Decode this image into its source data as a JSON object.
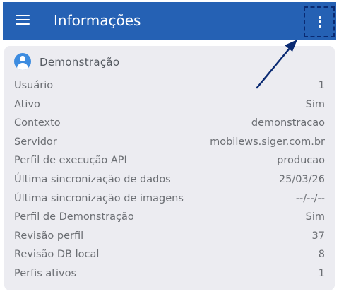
{
  "appbar": {
    "title": "Informações",
    "menu_icon": "hamburger-menu-icon",
    "overflow_icon": "more-vert-icon",
    "color": "#2561b4"
  },
  "card": {
    "icon": "user-avatar-icon",
    "title": "Demonstração",
    "rows": [
      {
        "label": "Usuário",
        "value": "1"
      },
      {
        "label": "Ativo",
        "value": "Sim"
      },
      {
        "label": "Contexto",
        "value": "demonstracao"
      },
      {
        "label": "Servidor",
        "value": "mobilews.siger.com.br"
      },
      {
        "label": "Perfil de execução API",
        "value": "producao"
      },
      {
        "label": "Última sincronização de dados",
        "value": "25/03/26"
      },
      {
        "label": "Última sincronização de imagens",
        "value": "--/--/--"
      },
      {
        "label": "Perfil de Demonstração",
        "value": "Sim"
      },
      {
        "label": "Revisão perfil",
        "value": "37"
      },
      {
        "label": "Revisão DB local",
        "value": "8"
      },
      {
        "label": "Perfis ativos",
        "value": "1"
      }
    ]
  },
  "annotation": {
    "arrow_color": "#0a2a72"
  }
}
